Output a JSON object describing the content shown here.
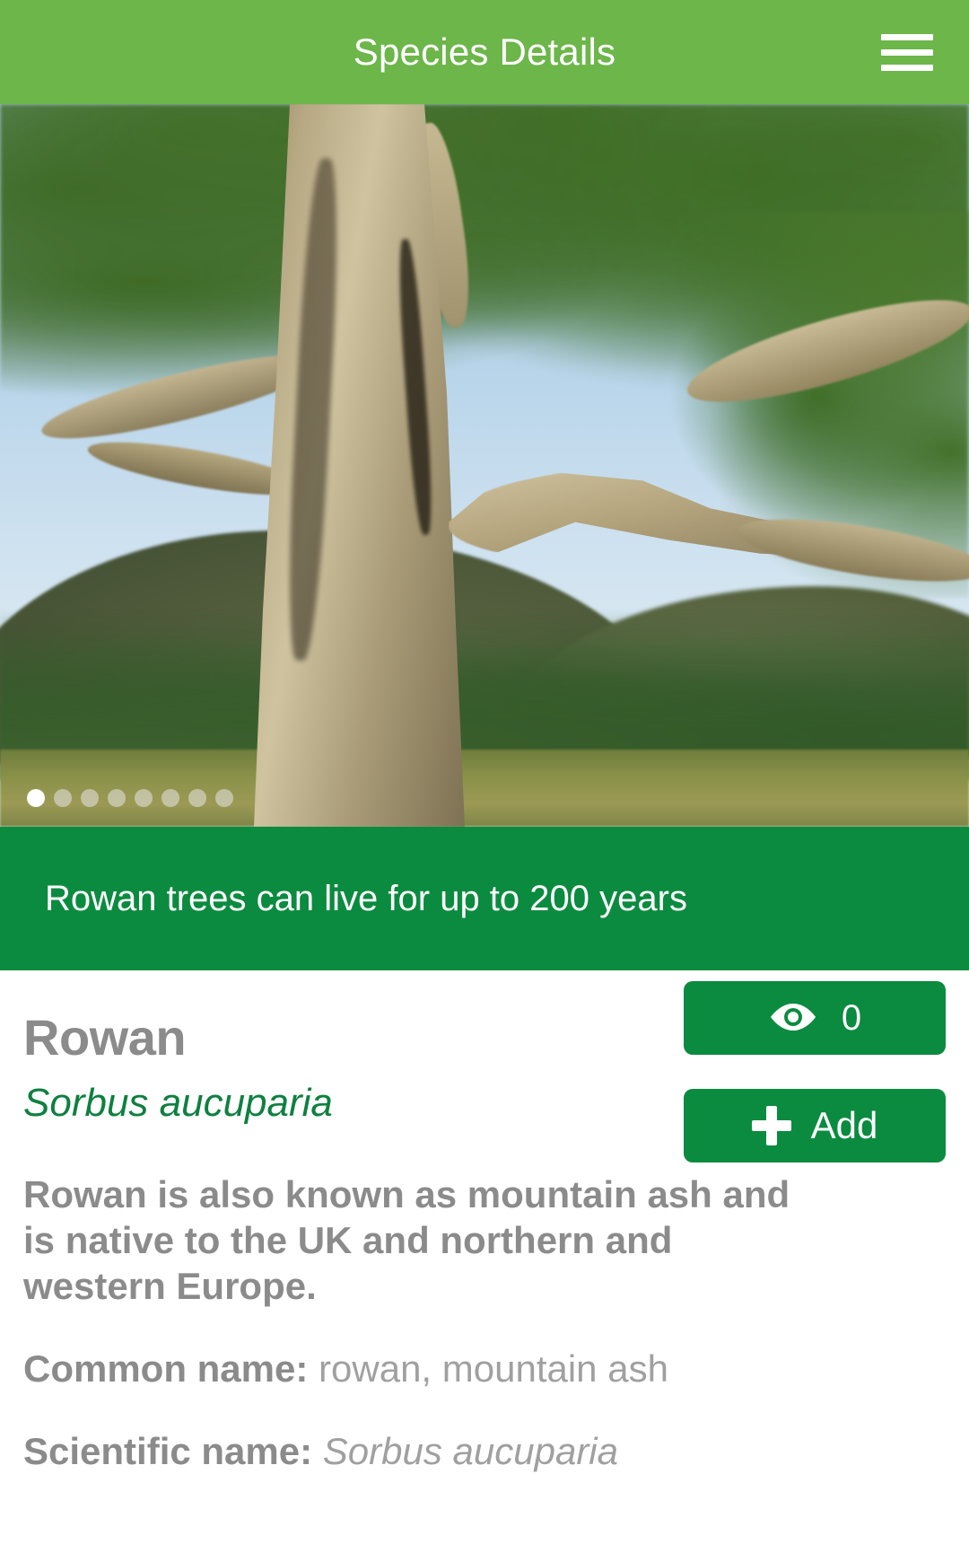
{
  "header": {
    "title": "Species Details",
    "menu_icon": "hamburger-menu-icon"
  },
  "hero": {
    "alt": "rowan-tree-photo",
    "carousel": {
      "total_dots": 8,
      "active_index": 0
    }
  },
  "fact_banner": {
    "text": "Rowan trees can live for up to 200 years",
    "background_color": "#0b8b3f"
  },
  "species": {
    "common_name": "Rowan",
    "scientific_name": "Sorbus aucuparia",
    "description": "Rowan is also known as mountain ash and is native to the UK and northern and western Europe.",
    "details": [
      {
        "label": "Common name:",
        "value": "rowan, mountain ash",
        "italic": false
      },
      {
        "label": "Scientific name:",
        "value": "Sorbus aucuparia",
        "italic": true
      }
    ]
  },
  "actions": {
    "views": {
      "icon": "eye-icon",
      "count": "0"
    },
    "add": {
      "icon": "plus-icon",
      "label": "Add"
    }
  },
  "colors": {
    "header_green": "#6cb64a",
    "accent_green": "#0b8b3f",
    "scientific_green": "#0e8040",
    "text_gray": "#8b8b8b"
  }
}
